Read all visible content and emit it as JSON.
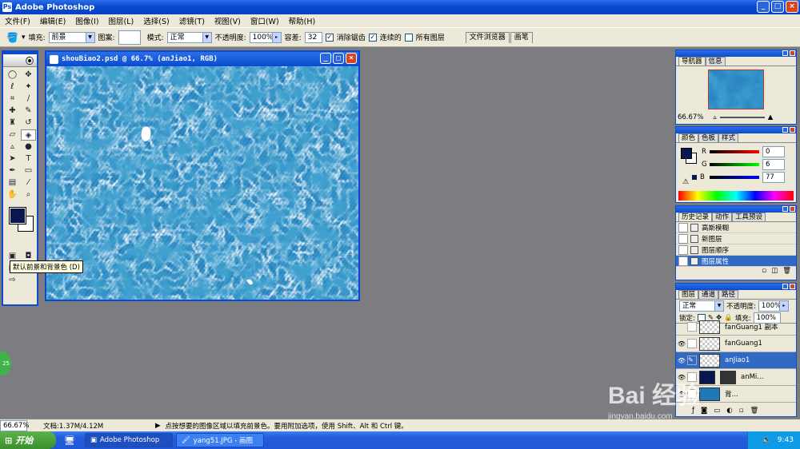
{
  "app": {
    "title": "Adobe Photoshop"
  },
  "menu": [
    "文件(F)",
    "编辑(E)",
    "图像(I)",
    "图层(L)",
    "选择(S)",
    "滤镜(T)",
    "视图(V)",
    "窗口(W)",
    "帮助(H)"
  ],
  "options": {
    "fill_label": "填充:",
    "fill_value": "前景",
    "pattern_label": "图案:",
    "mode_label": "模式:",
    "mode_value": "正常",
    "opacity_label": "不透明度:",
    "opacity_value": "100%",
    "tolerance_label": "容差:",
    "tolerance_value": "32",
    "antialias_label": "消除锯齿",
    "contiguous_label": "连续的",
    "all_layers_label": "所有图层",
    "well_tabs": [
      "文件浏览器",
      "画笔"
    ]
  },
  "document": {
    "title": "shouBiao2.psd @ 66.7% (anJiao1, RGB)"
  },
  "tooltip": "默认前景和背景色 (D)",
  "colors": {
    "foreground": "#0a1650",
    "background": "#ffffff",
    "canvas_base": "#1e79b8"
  },
  "navigator": {
    "tabs": [
      "导航器",
      "信息"
    ],
    "zoom": "66.67%"
  },
  "color_panel": {
    "tabs": [
      "颜色",
      "色板",
      "样式"
    ],
    "r_label": "R",
    "r_value": "0",
    "g_label": "G",
    "g_value": "6",
    "b_label": "B",
    "b_value": "77"
  },
  "history": {
    "tabs": [
      "历史记录",
      "动作",
      "工具预设"
    ],
    "items": [
      "高斯模糊",
      "新图层",
      "图层顺序",
      "图层属性"
    ]
  },
  "layers": {
    "tabs": [
      "图层",
      "通道",
      "路径"
    ],
    "blend": "正常",
    "opacity_label": "不透明度:",
    "opacity": "100%",
    "lock_label": "锁定:",
    "fill_label": "填充:",
    "fill": "100%",
    "items": [
      "fanGuang1 副本",
      "fanGuang1",
      "anJiao1",
      "anMi...",
      "背..."
    ]
  },
  "status": {
    "zoom": "66.67%",
    "doc": "文档:1.37M/4.12M",
    "hint": "点按想要的图像区域以填充前景色。要用附加选项，使用 Shift、Alt 和 Ctrl 键。"
  },
  "taskbar": {
    "start": "开始",
    "tasks": [
      "Adobe Photoshop",
      "yang51.JPG - 画图"
    ],
    "clock": "9:43",
    "badge": "25"
  },
  "watermark": {
    "brand": "Bai 经验",
    "url": "jingyan.baidu.com"
  }
}
